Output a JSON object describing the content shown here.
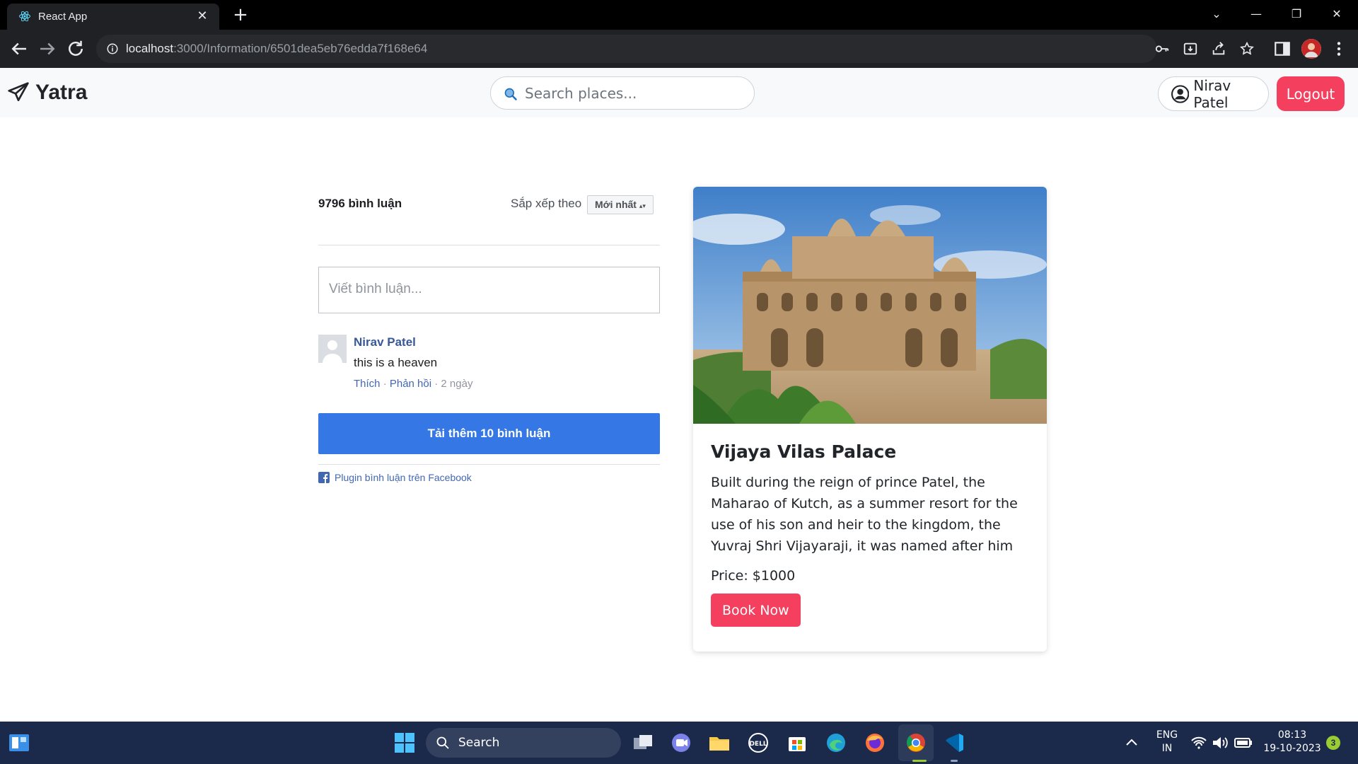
{
  "browser": {
    "tab_title": "React App",
    "url_host": "localhost",
    "url_path": ":3000/Information/6501dea5eb76edda7f168e64"
  },
  "navbar": {
    "brand": "Yatra",
    "search_placeholder": "Search places...",
    "user_name": "Nirav Patel",
    "logout_label": "Logout"
  },
  "comments": {
    "count_label": "9796 bình luận",
    "sort_label": "Sắp xếp theo",
    "sort_value": "Mới nhất",
    "input_placeholder": "Viết bình luận...",
    "items": [
      {
        "author": "Nirav Patel",
        "text": "this is a heaven",
        "like": "Thích",
        "reply": "Phản hồi",
        "time": "2 ngày"
      }
    ],
    "load_more_label": "Tải thêm 10 bình luận",
    "plugin_label": "Plugin bình luận trên Facebook"
  },
  "place": {
    "title": "Vijaya Vilas Palace",
    "description": "Built during the reign of prince Patel, the Maharao of Kutch, as a summer resort for the use of his son and heir to the kingdom, the Yuvraj Shri Vijayaraji, it was named after him as Vijaya Vilas Palace. The",
    "price": "Price: $1000",
    "book_label": "Book Now"
  },
  "taskbar": {
    "search_label": "Search",
    "lang_line1": "ENG",
    "lang_line2": "IN",
    "time": "08:13",
    "date": "19-10-2023",
    "notification_count": "3"
  },
  "colors": {
    "accent": "#f43f5e",
    "facebook_button": "#3578e5",
    "facebook_link": "#4267b2"
  }
}
